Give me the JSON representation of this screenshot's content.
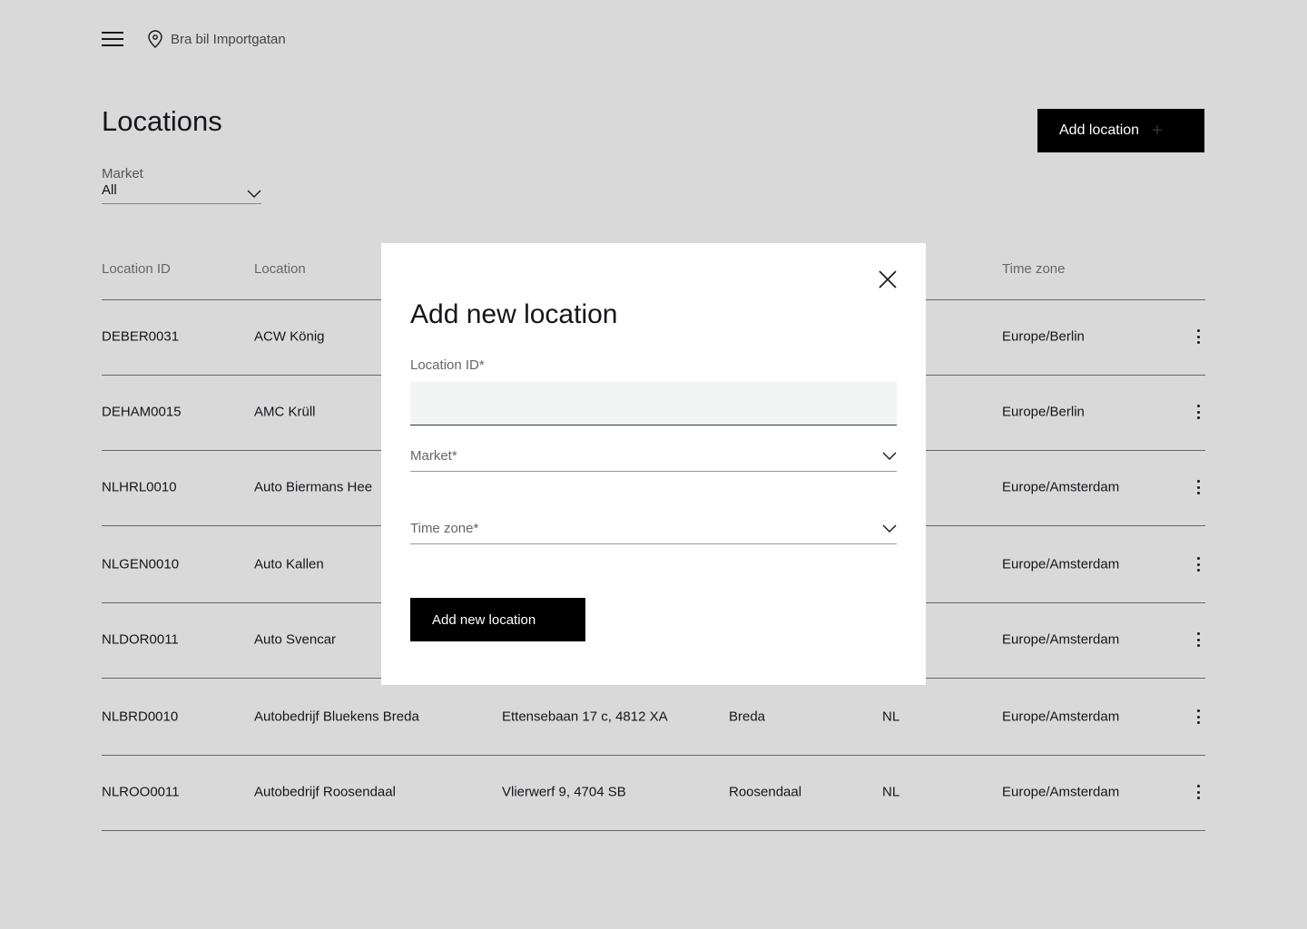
{
  "header": {
    "location_name": "Bra bil Importgatan"
  },
  "page": {
    "title": "Locations",
    "add_button": "Add location"
  },
  "filter": {
    "label": "Market",
    "value": "All"
  },
  "table": {
    "headers": {
      "id": "Location ID",
      "location": "Location",
      "timezone": "Time zone"
    },
    "rows": [
      {
        "id": "DEBER0031",
        "location": "ACW König",
        "address": "",
        "city": "",
        "market": "",
        "timezone": "Europe/Berlin"
      },
      {
        "id": "DEHAM0015",
        "location": "AMC Krüll",
        "address": "",
        "city": "",
        "market": "",
        "timezone": "Europe/Berlin"
      },
      {
        "id": "NLHRL0010",
        "location": "Auto Biermans Hee",
        "address": "",
        "city": "",
        "market": "",
        "timezone": "Europe/Amsterdam"
      },
      {
        "id": "NLGEN0010",
        "location": "Auto Kallen",
        "address": "",
        "city": "",
        "market": "",
        "timezone": "Europe/Amsterdam"
      },
      {
        "id": "NLDOR0011",
        "location": "Auto Svencar",
        "address": "",
        "city": "",
        "market": "",
        "timezone": "Europe/Amsterdam"
      },
      {
        "id": "NLBRD0010",
        "location": "Autobedrijf Bluekens Breda",
        "address": "Ettensebaan 17 c, 4812 XA",
        "city": "Breda",
        "market": "NL",
        "timezone": "Europe/Amsterdam"
      },
      {
        "id": "NLROO0011",
        "location": "Autobedrijf  Roosendaal",
        "address": "Vlierwerf 9, 4704 SB",
        "city": "Roosendaal",
        "market": "NL",
        "timezone": "Europe/Amsterdam"
      }
    ]
  },
  "modal": {
    "title": "Add new location",
    "location_id_label": "Location ID*",
    "location_id_value": "",
    "market_label": "Market*",
    "timezone_label": "Time zone*",
    "submit": "Add new location"
  }
}
